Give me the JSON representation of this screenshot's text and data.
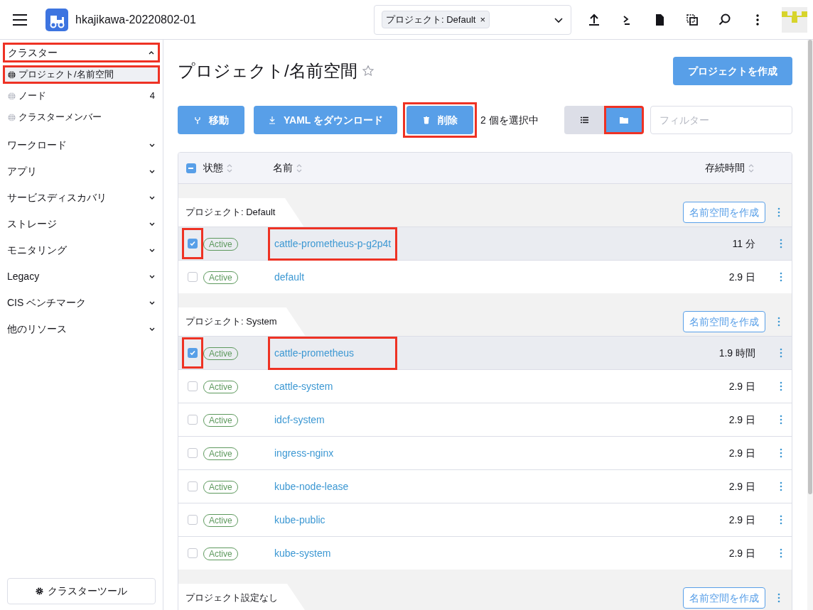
{
  "header": {
    "cluster_name": "hkajikawa-20220802-01",
    "namespace_filter": {
      "chip": "プロジェクト: Default",
      "remove": "×"
    }
  },
  "sidebar": {
    "cluster_section": {
      "label": "クラスター",
      "expanded": true,
      "highlighted": true,
      "items": [
        {
          "label": "プロジェクト/名前空間",
          "selected": true,
          "highlighted": true
        },
        {
          "label": "ノード",
          "count": "4",
          "selected": false,
          "highlighted": false
        },
        {
          "label": "クラスターメンバー",
          "selected": false,
          "highlighted": false
        }
      ]
    },
    "groups": [
      {
        "label": "ワークロード",
        "expanded": false
      },
      {
        "label": "アプリ",
        "expanded": false
      },
      {
        "label": "サービスディスカバリ",
        "expanded": false
      },
      {
        "label": "ストレージ",
        "expanded": false
      },
      {
        "label": "モニタリング",
        "expanded": false
      },
      {
        "label": "Legacy",
        "expanded": false
      },
      {
        "label": "CIS ベンチマーク",
        "expanded": false
      },
      {
        "label": "他のリソース",
        "expanded": false
      }
    ],
    "footer_button": "クラスターツール"
  },
  "page": {
    "title": "プロジェクト/名前空間",
    "create_button": "プロジェクトを作成",
    "actions": [
      {
        "label": "移動",
        "highlighted": false
      },
      {
        "label": "YAML をダウンロード",
        "highlighted": false
      },
      {
        "label": "削除",
        "highlighted": true
      }
    ],
    "selection_count": "2 個を選択中",
    "view_toggle": [
      {
        "kind": "list",
        "selected": false,
        "highlighted": false
      },
      {
        "kind": "folder",
        "selected": true,
        "highlighted": true
      }
    ],
    "filter": {
      "placeholder": "フィルター"
    }
  },
  "table": {
    "select_all": {
      "checked": true,
      "indeterminate": true
    },
    "columns": [
      "状態",
      "名前",
      "存続時間"
    ],
    "groups": [
      {
        "label": "プロジェクト: Default",
        "button": "名前空間を作成",
        "rows": [
          {
            "checked": true,
            "highlighted": true,
            "status": "Active",
            "name": "cattle-prometheus-p-g2p4t",
            "age": "11 分"
          },
          {
            "checked": false,
            "highlighted": false,
            "status": "Active",
            "name": "default",
            "age": "2.9 日"
          }
        ]
      },
      {
        "label": "プロジェクト: System",
        "button": "名前空間を作成",
        "rows": [
          {
            "checked": true,
            "highlighted": true,
            "status": "Active",
            "name": "cattle-prometheus",
            "age": "1.9 時間"
          },
          {
            "checked": false,
            "highlighted": false,
            "status": "Active",
            "name": "cattle-system",
            "age": "2.9 日"
          },
          {
            "checked": false,
            "highlighted": false,
            "status": "Active",
            "name": "idcf-system",
            "age": "2.9 日"
          },
          {
            "checked": false,
            "highlighted": false,
            "status": "Active",
            "name": "ingress-nginx",
            "age": "2.9 日"
          },
          {
            "checked": false,
            "highlighted": false,
            "status": "Active",
            "name": "kube-node-lease",
            "age": "2.9 日"
          },
          {
            "checked": false,
            "highlighted": false,
            "status": "Active",
            "name": "kube-public",
            "age": "2.9 日"
          },
          {
            "checked": false,
            "highlighted": false,
            "status": "Active",
            "name": "kube-system",
            "age": "2.9 日"
          }
        ]
      },
      {
        "label": "プロジェクト設定なし",
        "button": "名前空間を作成"
      }
    ]
  }
}
